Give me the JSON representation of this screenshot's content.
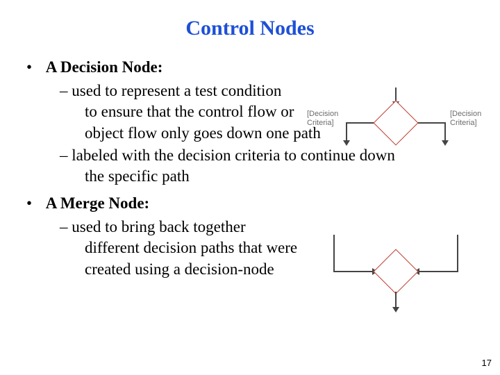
{
  "title": "Control Nodes",
  "bullets": {
    "decision": {
      "heading": "A Decision Node:",
      "sub1_l1": "used to represent a test condition",
      "sub1_l2": "to ensure that the control flow or",
      "sub1_l3": "object flow only goes down one path",
      "sub2_l1": "labeled with the decision criteria to continue down",
      "sub2_l2": "the specific path"
    },
    "merge": {
      "heading": "A Merge Node:",
      "sub1_l1": "used to bring back together",
      "sub1_l2": "different decision paths that were",
      "sub1_l3": "created using a decision-node"
    }
  },
  "figures": {
    "decision": {
      "label_left": "[Decision Criteria]",
      "label_right": "[Decision Criteria]"
    }
  },
  "page_number": "17"
}
